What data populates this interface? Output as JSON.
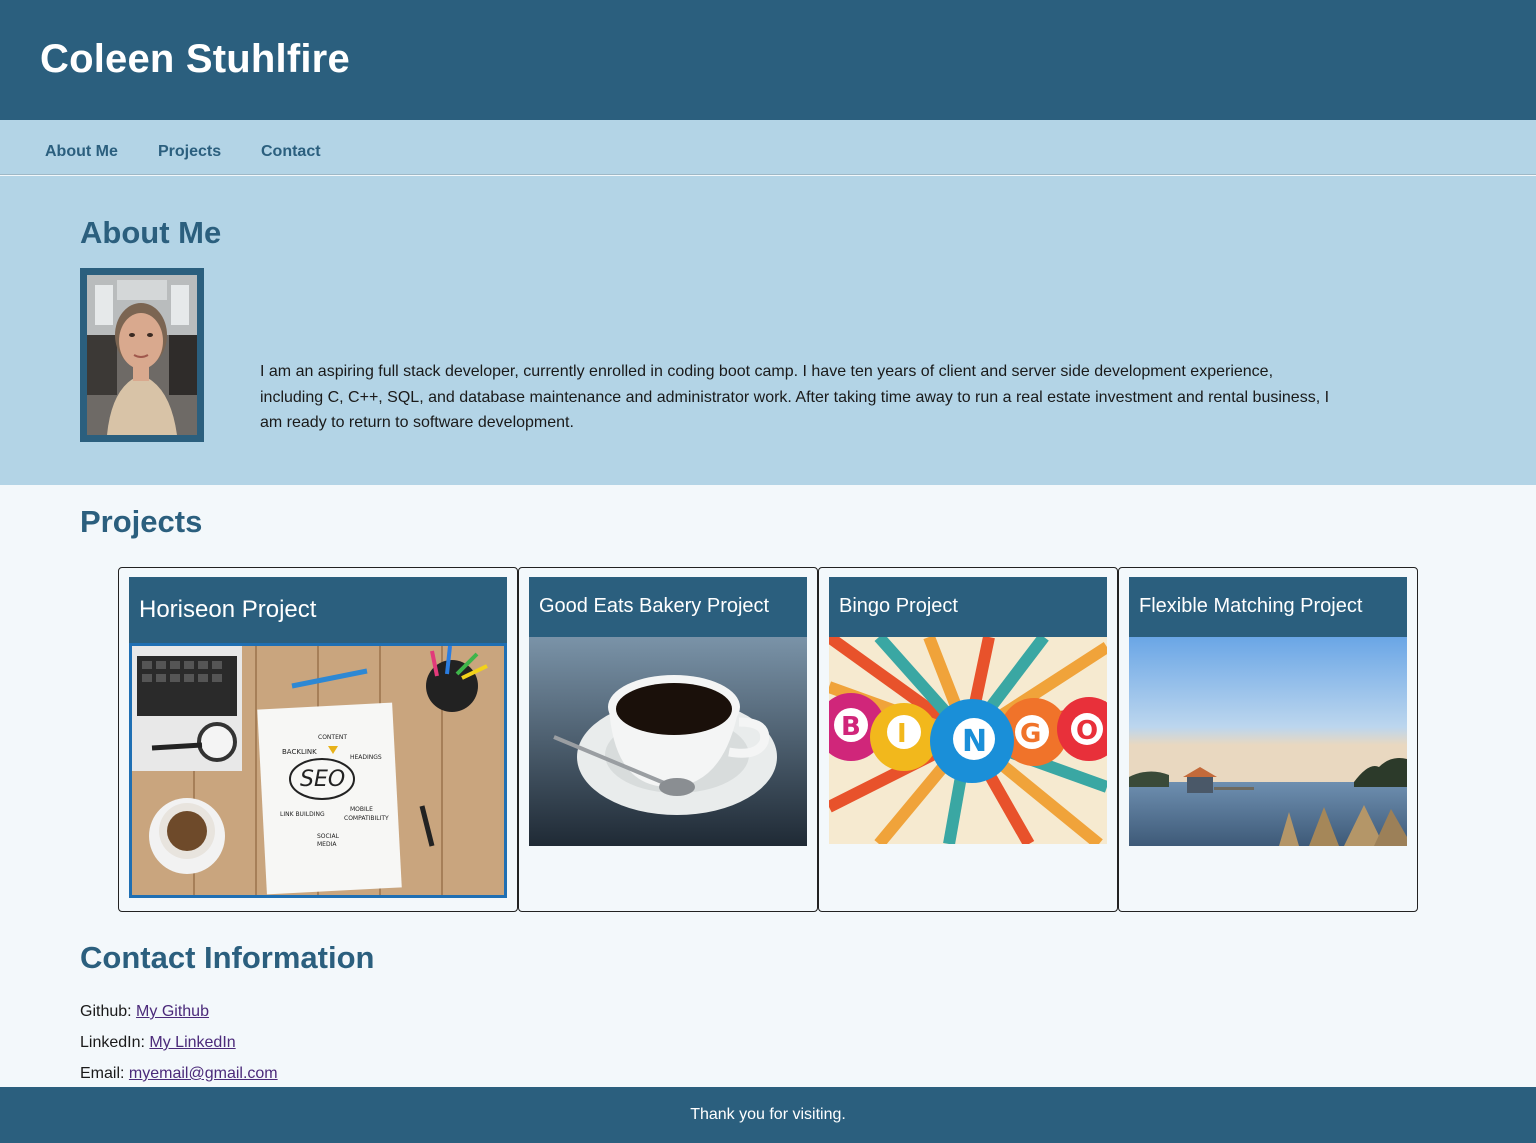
{
  "header": {
    "title": "Coleen Stuhlfire"
  },
  "nav": {
    "items": [
      "About Me",
      "Projects",
      "Contact"
    ]
  },
  "about": {
    "heading": "About Me",
    "photo_icon": "profile-photo",
    "text": "I am an aspiring full stack developer, currently enrolled in coding boot camp. I have ten years of client and server side development experience, including C, C++, SQL, and database maintenance and administrator work. After taking time away to run a real estate investment and rental business, I am ready to return to software development."
  },
  "projects": {
    "heading": "Projects",
    "cards": [
      {
        "title": "Horiseon Project",
        "image": "seo-notebook-image"
      },
      {
        "title": "Good Eats Bakery Project",
        "image": "coffee-cup-image"
      },
      {
        "title": "Bingo Project",
        "image": "bingo-balls-image"
      },
      {
        "title": "Flexible Matching Project",
        "image": "lake-boathouse-image"
      }
    ]
  },
  "contact": {
    "heading": "Contact Information",
    "github_label": "Github:",
    "github_link": "My Github",
    "linkedin_label": "LinkedIn:",
    "linkedin_link": "My LinkedIn",
    "email_label": "Email:",
    "email_link": "myemail@gmail.com"
  },
  "footer": {
    "text": "Thank you for visiting."
  },
  "colors": {
    "primary": "#2b5f7e",
    "light": "#b3d4e6",
    "background": "#f3f8fb",
    "link": "#4b2a7a"
  }
}
